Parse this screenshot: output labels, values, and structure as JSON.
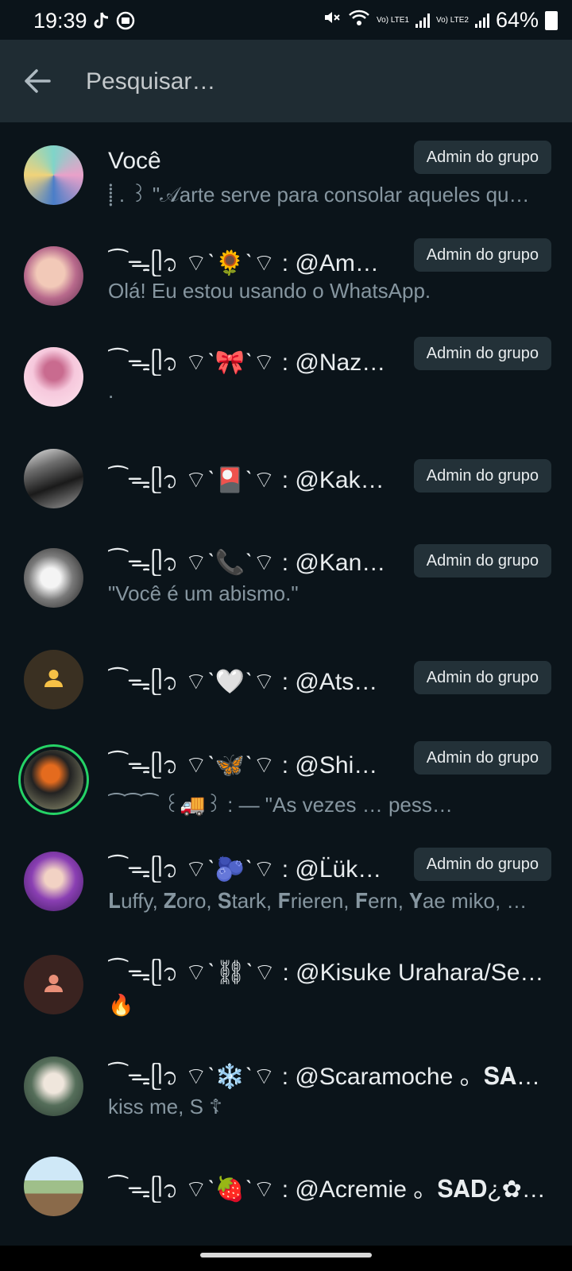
{
  "status_bar": {
    "time": "19:39",
    "battery": "64%",
    "sim1_label": "Vo) LTE1",
    "sim2_label": "Vo) LTE2",
    "icons": [
      "tiktok-icon",
      "media-icon",
      "mute-icon",
      "wifi-icon",
      "signal-icon",
      "battery-icon"
    ]
  },
  "search": {
    "placeholder": "Pesquisar…"
  },
  "members": [
    {
      "name": "Você",
      "status": "⸽ . ꒱ \"𝒜arte serve para consolar aqueles qu…",
      "badge": "Admin do grupo",
      "avatar": "anime-art"
    },
    {
      "name": "⁀ᯓᥫ᭡ ⌔ˋ🌻ˋ⌔ : @Amor…",
      "status": "Olá! Eu estou usando o WhatsApp.",
      "badge": "Admin do grupo",
      "avatar": "anime-art"
    },
    {
      "name": "⁀ᯓᥫ᭡ ⌔ˋ🎀ˋ⌔ : @Nazun…",
      "status": ".",
      "badge": "Admin do grupo",
      "avatar": "pink-art"
    },
    {
      "name": "⁀ᯓᥫ᭡ ⌔ˋ🎴ˋ⌔ : @Kakuc…",
      "status": "",
      "badge": "Admin do grupo",
      "avatar": "dark-photo"
    },
    {
      "name": "⁀ᯓᥫ᭡ ⌔ˋ📞ˋ⌔ : @Kanek…",
      "status": "\"Você é um abismo.\"",
      "badge": "Admin do grupo",
      "avatar": "manga-art"
    },
    {
      "name": "⁀ᯓᥫ᭡ ⌔ˋ🤍ˋ⌔ : @Atsus…",
      "status": "",
      "badge": "Admin do grupo",
      "avatar": "default-person"
    },
    {
      "name": "⁀ᯓᥫ᭡ ⌔ˋ🦋ˋ⌔ : @Shino…",
      "status": "⁀⁀⁀ ꒰🚚꒱ : — \"As vezes  … pess…",
      "badge": "Admin do grupo",
      "avatar": "story-photo"
    },
    {
      "name": "⁀ᯓᥫ᭡ ⌔ˋ🫐ˋ⌔ : @L̈üke̋ •…",
      "status": "𝐋uffy, 𝐙oro, 𝐒tark, 𝐅rieren, 𝐅ern, 𝐘ae miko, …",
      "badge": "Admin do grupo",
      "avatar": "purple-art"
    },
    {
      "name": "⁀ᯓᥫ᭡ ⌔ˋ⛓ˋ⌔ : @Kisuke Urahara/Sep…",
      "status": "🔥",
      "badge": "",
      "avatar": "default-person"
    },
    {
      "name": "⁀ᯓᥫ᭡ ⌔ˋ❄️ˋ⌔ : @Scaramoche 。𝐒𝐀𝐃…",
      "status": "kiss me, S ☦",
      "badge": "",
      "avatar": "green-art"
    },
    {
      "name": "⁀ᯓᥫ᭡ ⌔ˋ🍓ˋ⌔ : @Acremie 。𝐒𝐀𝐃¿✿ᨳ…",
      "status": "",
      "badge": "",
      "avatar": "game-art"
    }
  ],
  "colors": {
    "background": "#0b141a",
    "header": "#1f2c33",
    "badge_bg": "#233138",
    "secondary_text": "#8696a0",
    "story_ring": "#25d366"
  }
}
